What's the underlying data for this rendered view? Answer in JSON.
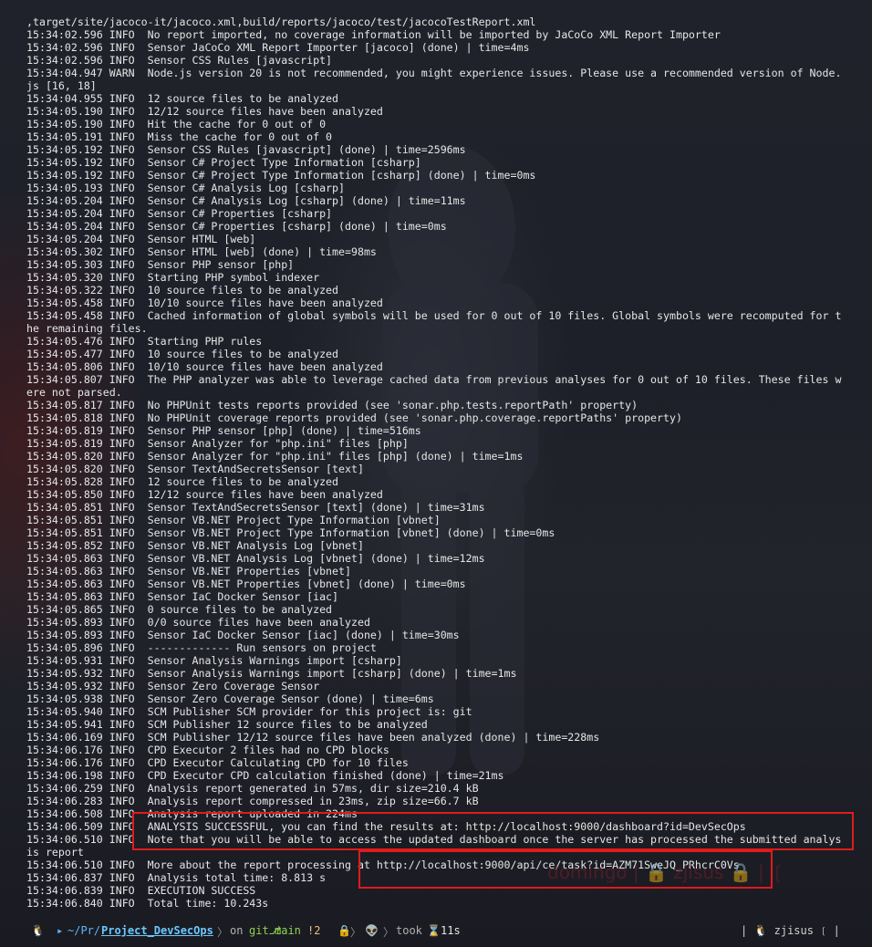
{
  "log_lines": [
    ",target/site/jacoco-it/jacoco.xml,build/reports/jacoco/test/jacocoTestReport.xml",
    "15:34:02.596 INFO  No report imported, no coverage information will be imported by JaCoCo XML Report Importer",
    "15:34:02.596 INFO  Sensor JaCoCo XML Report Importer [jacoco] (done) | time=4ms",
    "15:34:02.596 INFO  Sensor CSS Rules [javascript]",
    "15:34:04.947 WARN  Node.js version 20 is not recommended, you might experience issues. Please use a recommended version of Node.",
    "js [16, 18]",
    "15:34:04.955 INFO  12 source files to be analyzed",
    "15:34:05.190 INFO  12/12 source files have been analyzed",
    "15:34:05.190 INFO  Hit the cache for 0 out of 0",
    "15:34:05.191 INFO  Miss the cache for 0 out of 0",
    "15:34:05.192 INFO  Sensor CSS Rules [javascript] (done) | time=2596ms",
    "15:34:05.192 INFO  Sensor C# Project Type Information [csharp]",
    "15:34:05.192 INFO  Sensor C# Project Type Information [csharp] (done) | time=0ms",
    "15:34:05.193 INFO  Sensor C# Analysis Log [csharp]",
    "15:34:05.204 INFO  Sensor C# Analysis Log [csharp] (done) | time=11ms",
    "15:34:05.204 INFO  Sensor C# Properties [csharp]",
    "15:34:05.204 INFO  Sensor C# Properties [csharp] (done) | time=0ms",
    "15:34:05.204 INFO  Sensor HTML [web]",
    "15:34:05.302 INFO  Sensor HTML [web] (done) | time=98ms",
    "15:34:05.303 INFO  Sensor PHP sensor [php]",
    "15:34:05.320 INFO  Starting PHP symbol indexer",
    "15:34:05.322 INFO  10 source files to be analyzed",
    "15:34:05.458 INFO  10/10 source files have been analyzed",
    "15:34:05.458 INFO  Cached information of global symbols will be used for 0 out of 10 files. Global symbols were recomputed for t",
    "he remaining files.",
    "15:34:05.476 INFO  Starting PHP rules",
    "15:34:05.477 INFO  10 source files to be analyzed",
    "15:34:05.806 INFO  10/10 source files have been analyzed",
    "15:34:05.807 INFO  The PHP analyzer was able to leverage cached data from previous analyses for 0 out of 10 files. These files w",
    "ere not parsed.",
    "15:34:05.817 INFO  No PHPUnit tests reports provided (see 'sonar.php.tests.reportPath' property)",
    "15:34:05.818 INFO  No PHPUnit coverage reports provided (see 'sonar.php.coverage.reportPaths' property)",
    "15:34:05.819 INFO  Sensor PHP sensor [php] (done) | time=516ms",
    "15:34:05.819 INFO  Sensor Analyzer for \"php.ini\" files [php]",
    "15:34:05.820 INFO  Sensor Analyzer for \"php.ini\" files [php] (done) | time=1ms",
    "15:34:05.820 INFO  Sensor TextAndSecretsSensor [text]",
    "15:34:05.828 INFO  12 source files to be analyzed",
    "15:34:05.850 INFO  12/12 source files have been analyzed",
    "15:34:05.851 INFO  Sensor TextAndSecretsSensor [text] (done) | time=31ms",
    "15:34:05.851 INFO  Sensor VB.NET Project Type Information [vbnet]",
    "15:34:05.851 INFO  Sensor VB.NET Project Type Information [vbnet] (done) | time=0ms",
    "15:34:05.852 INFO  Sensor VB.NET Analysis Log [vbnet]",
    "15:34:05.863 INFO  Sensor VB.NET Analysis Log [vbnet] (done) | time=12ms",
    "15:34:05.863 INFO  Sensor VB.NET Properties [vbnet]",
    "15:34:05.863 INFO  Sensor VB.NET Properties [vbnet] (done) | time=0ms",
    "15:34:05.863 INFO  Sensor IaC Docker Sensor [iac]",
    "15:34:05.865 INFO  0 source files to be analyzed",
    "15:34:05.893 INFO  0/0 source files have been analyzed",
    "15:34:05.893 INFO  Sensor IaC Docker Sensor [iac] (done) | time=30ms",
    "15:34:05.896 INFO  ------------- Run sensors on project",
    "15:34:05.931 INFO  Sensor Analysis Warnings import [csharp]",
    "15:34:05.932 INFO  Sensor Analysis Warnings import [csharp] (done) | time=1ms",
    "15:34:05.932 INFO  Sensor Zero Coverage Sensor",
    "15:34:05.938 INFO  Sensor Zero Coverage Sensor (done) | time=6ms",
    "15:34:05.940 INFO  SCM Publisher SCM provider for this project is: git",
    "15:34:05.941 INFO  SCM Publisher 12 source files to be analyzed",
    "15:34:06.169 INFO  SCM Publisher 12/12 source files have been analyzed (done) | time=228ms",
    "15:34:06.176 INFO  CPD Executor 2 files had no CPD blocks",
    "15:34:06.176 INFO  CPD Executor Calculating CPD for 10 files",
    "15:34:06.198 INFO  CPD Executor CPD calculation finished (done) | time=21ms",
    "15:34:06.259 INFO  Analysis report generated in 57ms, dir size=210.4 kB",
    "15:34:06.283 INFO  Analysis report compressed in 23ms, zip size=66.7 kB",
    "15:34:06.508 INFO  Analysis report uploaded in 224ms",
    "15:34:06.509 INFO  ANALYSIS SUCCESSFUL, you can find the results at: http://localhost:9000/dashboard?id=DevSecOps",
    "15:34:06.510 INFO  Note that you will be able to access the updated dashboard once the server has processed the submitted analys",
    "is report",
    "15:34:06.510 INFO  More about the report processing at http://localhost:9000/api/ce/task?id=AZM71SweJQ_PRhcrC0Vs",
    "15:34:06.837 INFO  Analysis total time: 8.813 s",
    "15:34:06.839 INFO  EXECUTION SUCCESS",
    "15:34:06.840 INFO  Total time: 10.243s"
  ],
  "watermark": "domingo | 🔒 zjisus 🔒 | ❲",
  "prompt": {
    "os_icon": "🐧",
    "folder_icon": "▸",
    "path_prefix": "~/Pr/",
    "path_current": "Project_DevSecOps",
    "arrow": "〉",
    "on_label": "on",
    "git_icon": "git⎇",
    "branch": "main",
    "modified": "!2",
    "lock_icon": "🔒",
    "alien_icon": "👽",
    "took_label": "took",
    "hourglass_icon": "⌛",
    "duration": "11s",
    "right_status": "| 🐧 zjisus ❲ |"
  },
  "colors": {
    "highlight": "#e01b1b",
    "text": "#e6e6e6",
    "path": "#5fb4ff",
    "branch": "#8fd14f"
  }
}
